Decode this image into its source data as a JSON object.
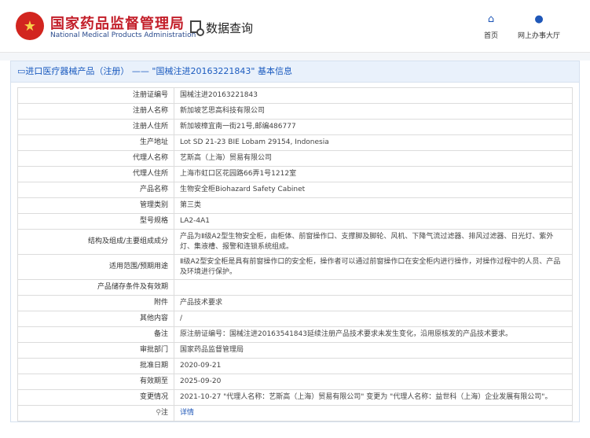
{
  "header": {
    "brand_cn": "国家药品监督管理局",
    "brand_en": "National Medical Products Administration",
    "query_label": "数据查询",
    "nav_home": "首页",
    "nav_online": "网上办事大厅"
  },
  "panel": {
    "title": "▭进口医疗器械产品（注册） —— \"国械注进20163221843\" 基本信息"
  },
  "rows": [
    {
      "label": "注册证编号",
      "value": "国械注进20163221843"
    },
    {
      "label": "注册人名称",
      "value": "新加坡艺思高科技有限公司"
    },
    {
      "label": "注册人住所",
      "value": "新加坡樟宜南一街21号,邮编486777"
    },
    {
      "label": "生产地址",
      "value": "Lot SD 21-23 BIE Lobam 29154, Indonesia"
    },
    {
      "label": "代理人名称",
      "value": "艺斯高（上海）贸易有限公司"
    },
    {
      "label": "代理人住所",
      "value": "上海市虹口区花园路66弄1号1212室"
    },
    {
      "label": "产品名称",
      "value": "生物安全柜Biohazard Safety Cabinet"
    },
    {
      "label": "管理类别",
      "value": "第三类"
    },
    {
      "label": "型号规格",
      "value": "LA2-4A1"
    },
    {
      "label": "结构及组成/主要组成成分",
      "value": "产品为Ⅱ级A2型生物安全柜，由柜体、前窗操作口、支撑脚及脚轮、风机、下降气流过滤器、排风过滤器、日光灯、紫外灯、集液槽、报警和连锁系统组成。"
    },
    {
      "label": "适用范围/预期用途",
      "value": "Ⅱ级A2型安全柜是具有前窗操作口的安全柜，操作者可以通过前窗操作口在安全柜内进行操作，对操作过程中的人员、产品及环境进行保护。"
    },
    {
      "label": "产品储存条件及有效期",
      "value": ""
    },
    {
      "label": "附件",
      "value": "产品技术要求"
    },
    {
      "label": "其他内容",
      "value": "/"
    },
    {
      "label": "备注",
      "value": "原注册证编号：国械注进20163541843延续注册产品技术要求未发生变化，沿用原核发的产品技术要求。"
    },
    {
      "label": "审批部门",
      "value": "国家药品监督管理局"
    },
    {
      "label": "批准日期",
      "value": "2020-09-21"
    },
    {
      "label": "有效期至",
      "value": "2025-09-20"
    },
    {
      "label": "变更情况",
      "value": "2021-10-27 \"代理人名称：艺斯高（上海）贸易有限公司\" 变更为 \"代理人名称：益世科（上海）企业发展有限公司\"。"
    }
  ],
  "note": {
    "label": "注",
    "icon": "pin-icon",
    "link": "详情"
  }
}
